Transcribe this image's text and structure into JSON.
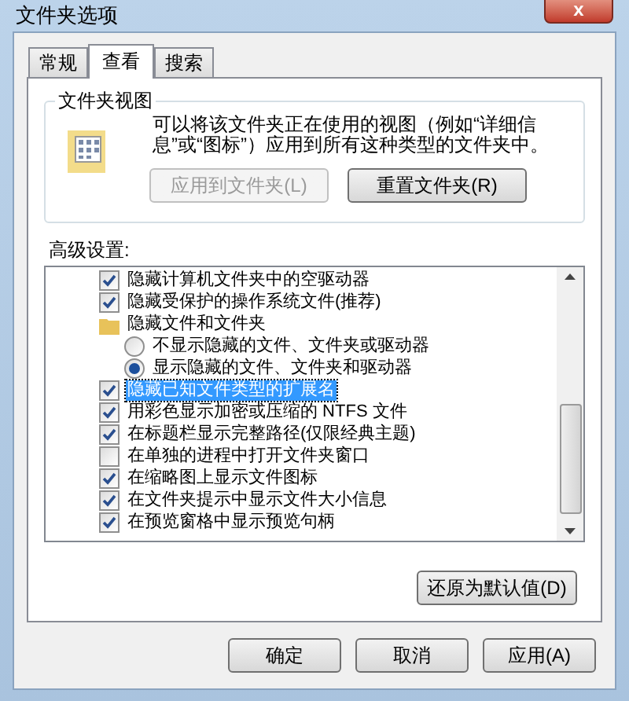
{
  "window": {
    "title": "文件夹选项",
    "close": "x"
  },
  "tabs": [
    {
      "label": "常规",
      "selected": false
    },
    {
      "label": "查看",
      "selected": true
    },
    {
      "label": "搜索",
      "selected": false
    }
  ],
  "folder_views": {
    "title": "文件夹视图",
    "description": "可以将该文件夹正在使用的视图（例如“详细信息”或“图标”）应用到所有这种类型的文件夹中。",
    "buttons": [
      {
        "label": "应用到文件夹(L)",
        "disabled": true
      },
      {
        "label": "重置文件夹(R)",
        "disabled": false
      }
    ]
  },
  "advanced": {
    "label": "高级设置:",
    "items": [
      {
        "kind": "checkbox",
        "label": "隐藏计算机文件夹中的空驱动器",
        "checked": true,
        "selected": false
      },
      {
        "kind": "checkbox",
        "label": "隐藏受保护的操作系统文件(推荐)",
        "checked": true,
        "selected": false
      },
      {
        "kind": "folder",
        "label": "隐藏文件和文件夹",
        "selected": false,
        "children": [
          {
            "kind": "radio",
            "label": "不显示隐藏的文件、文件夹或驱动器",
            "checked": false,
            "selected": false
          },
          {
            "kind": "radio",
            "label": "显示隐藏的文件、文件夹和驱动器",
            "checked": true,
            "selected": false
          }
        ]
      },
      {
        "kind": "checkbox",
        "label": "隐藏已知文件类型的扩展名",
        "checked": true,
        "selected": true
      },
      {
        "kind": "checkbox",
        "label": "用彩色显示加密或压缩的 NTFS 文件",
        "checked": true,
        "selected": false
      },
      {
        "kind": "checkbox",
        "label": "在标题栏显示完整路径(仅限经典主题)",
        "checked": true,
        "selected": false
      },
      {
        "kind": "checkbox",
        "label": "在单独的进程中打开文件夹窗口",
        "checked": false,
        "selected": false
      },
      {
        "kind": "checkbox",
        "label": "在缩略图上显示文件图标",
        "checked": true,
        "selected": false
      },
      {
        "kind": "checkbox",
        "label": "在文件夹提示中显示文件大小信息",
        "checked": true,
        "selected": false
      },
      {
        "kind": "checkbox",
        "label": "在预览窗格中显示预览句柄",
        "checked": true,
        "selected": false
      }
    ],
    "restore_button": "还原为默认值(D)"
  },
  "buttons": [
    "确定",
    "取消",
    "应用(A)"
  ]
}
